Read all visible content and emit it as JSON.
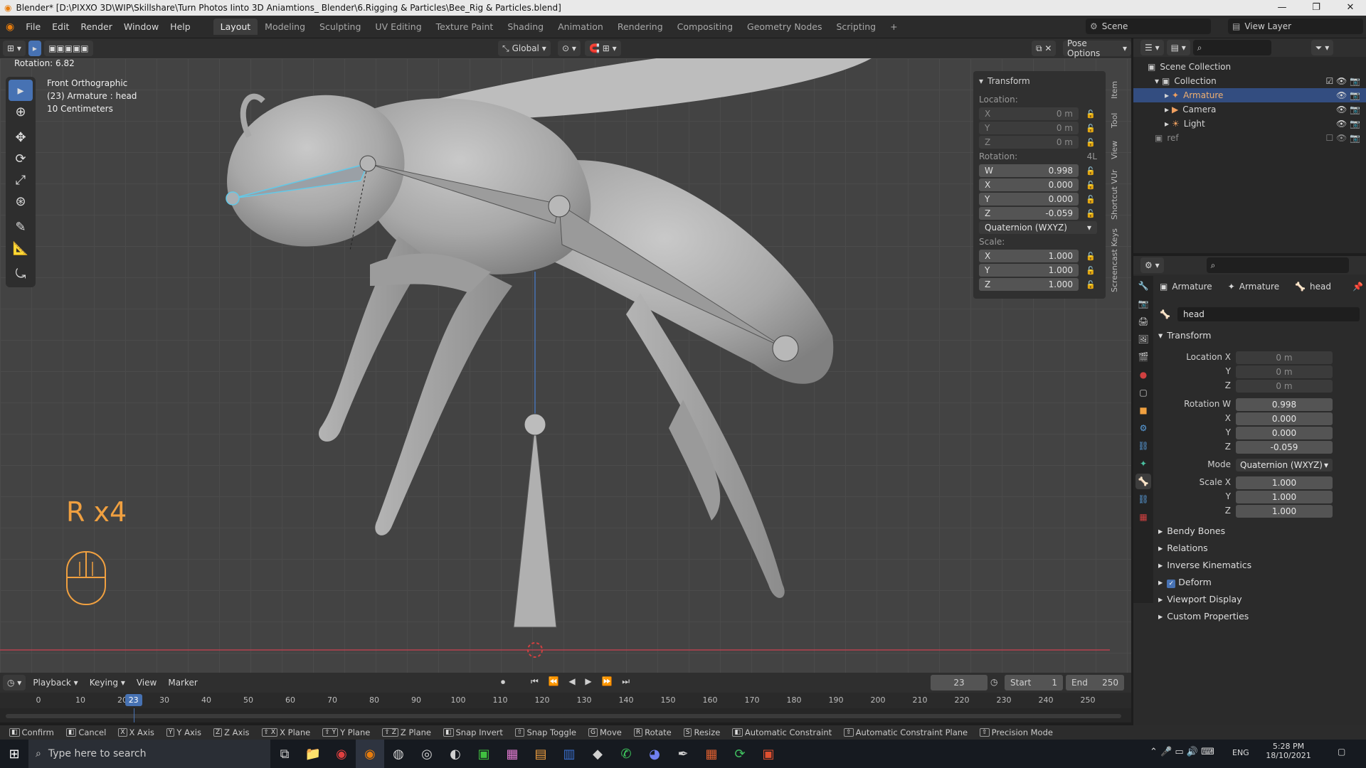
{
  "window": {
    "title": "Blender* [D:\\PIXXO 3D\\WIP\\Skillshare\\Turn Photos Iinto 3D Aniamtions_ Blender\\6.Rigging & Particles\\Bee_Rig & Particles.blend]",
    "minimize": "—",
    "maximize": "❐",
    "close": "✕"
  },
  "menu": [
    "File",
    "Edit",
    "Render",
    "Window",
    "Help"
  ],
  "workspaces": [
    "Layout",
    "Modeling",
    "Sculpting",
    "UV Editing",
    "Texture Paint",
    "Shading",
    "Animation",
    "Rendering",
    "Compositing",
    "Geometry Nodes",
    "Scripting",
    "+"
  ],
  "scene_name": "Scene",
  "view_layer": "View Layer",
  "viewport": {
    "orientation": "Global",
    "pose_options": "Pose Options",
    "operator_info": "Rotation: 6.82",
    "view_name": "Front Orthographic",
    "object_info": "(23) Armature : head",
    "scale_info": "10 Centimeters",
    "overlay_text": "R x4"
  },
  "npanel": {
    "header": "Transform",
    "location_label": "Location:",
    "location": [
      {
        "axis": "X",
        "value": "0 m"
      },
      {
        "axis": "Y",
        "value": "0 m"
      },
      {
        "axis": "Z",
        "value": "0 m"
      }
    ],
    "rotation_label": "Rotation:",
    "rotation_mode_short": "4L",
    "rotation": [
      {
        "axis": "W",
        "value": "0.998"
      },
      {
        "axis": "X",
        "value": "0.000"
      },
      {
        "axis": "Y",
        "value": "0.000"
      },
      {
        "axis": "Z",
        "value": "-0.059"
      }
    ],
    "rotation_mode": "Quaternion (WXYZ)",
    "scale_label": "Scale:",
    "scale": [
      {
        "axis": "X",
        "value": "1.000"
      },
      {
        "axis": "Y",
        "value": "1.000"
      },
      {
        "axis": "Z",
        "value": "1.000"
      }
    ],
    "tabs": [
      "Item",
      "Tool",
      "View",
      "Shortcut VUr",
      "Screencast Keys"
    ]
  },
  "outliner": {
    "items": [
      {
        "label": "Scene Collection"
      },
      {
        "label": "Collection"
      },
      {
        "label": "Armature"
      },
      {
        "label": "Camera"
      },
      {
        "label": "Light"
      },
      {
        "label": "ref"
      }
    ]
  },
  "properties": {
    "breadcrumb": [
      "Armature",
      "Armature",
      "head"
    ],
    "bone_name": "head",
    "transform_header": "Transform",
    "location_labels": [
      "Location X",
      "Y",
      "Z"
    ],
    "location_values": [
      "0 m",
      "0 m",
      "0 m"
    ],
    "rotation_labels": [
      "Rotation W",
      "X",
      "Y",
      "Z"
    ],
    "rotation_values": [
      "0.998",
      "0.000",
      "0.000",
      "-0.059"
    ],
    "mode_label": "Mode",
    "mode_value": "Quaternion (WXYZ)",
    "scale_labels": [
      "Scale X",
      "Y",
      "Z"
    ],
    "scale_values": [
      "1.000",
      "1.000",
      "1.000"
    ],
    "sections": [
      "Bendy Bones",
      "Relations",
      "Inverse Kinematics",
      "Deform",
      "Viewport Display",
      "Custom Properties"
    ]
  },
  "timeline": {
    "menus": [
      "Playback",
      "Keying",
      "View",
      "Marker"
    ],
    "current_frame": "23",
    "start_label": "Start",
    "start": "1",
    "end_label": "End",
    "end": "250",
    "ticks": [
      "0",
      "10",
      "20",
      "30",
      "40",
      "50",
      "60",
      "70",
      "80",
      "90",
      "100",
      "110",
      "120",
      "130",
      "140",
      "150",
      "160",
      "170",
      "180",
      "190",
      "200",
      "210",
      "220",
      "230",
      "240",
      "250"
    ],
    "playhead_label": "23"
  },
  "statusbar": [
    {
      "key": "",
      "label": "Confirm"
    },
    {
      "key": "",
      "label": "Cancel"
    },
    {
      "key": "X",
      "label": "X Axis"
    },
    {
      "key": "Y",
      "label": "Y Axis"
    },
    {
      "key": "Z",
      "label": "Z Axis"
    },
    {
      "key": "⇧ X",
      "label": "X Plane"
    },
    {
      "key": "⇧ Y",
      "label": "Y Plane"
    },
    {
      "key": "⇧ Z",
      "label": "Z Plane"
    },
    {
      "key": "",
      "label": "Snap Invert"
    },
    {
      "key": "⇧",
      "label": "Snap Toggle"
    },
    {
      "key": "G",
      "label": "Move"
    },
    {
      "key": "R",
      "label": "Rotate"
    },
    {
      "key": "S",
      "label": "Resize"
    },
    {
      "key": "",
      "label": "Automatic Constraint"
    },
    {
      "key": "⇧",
      "label": "Automatic Constraint Plane"
    },
    {
      "key": "⇧",
      "label": "Precision Mode"
    }
  ],
  "taskbar": {
    "search_placeholder": "Type here to search",
    "language": "ENG",
    "time": "5:28 PM",
    "date": "18/10/2021"
  },
  "colors": {
    "accent": "#4772b3",
    "selected_bone": "#62c9e8",
    "overlay_orange": "#f0a040",
    "frame_highlight": "#4772b3"
  }
}
